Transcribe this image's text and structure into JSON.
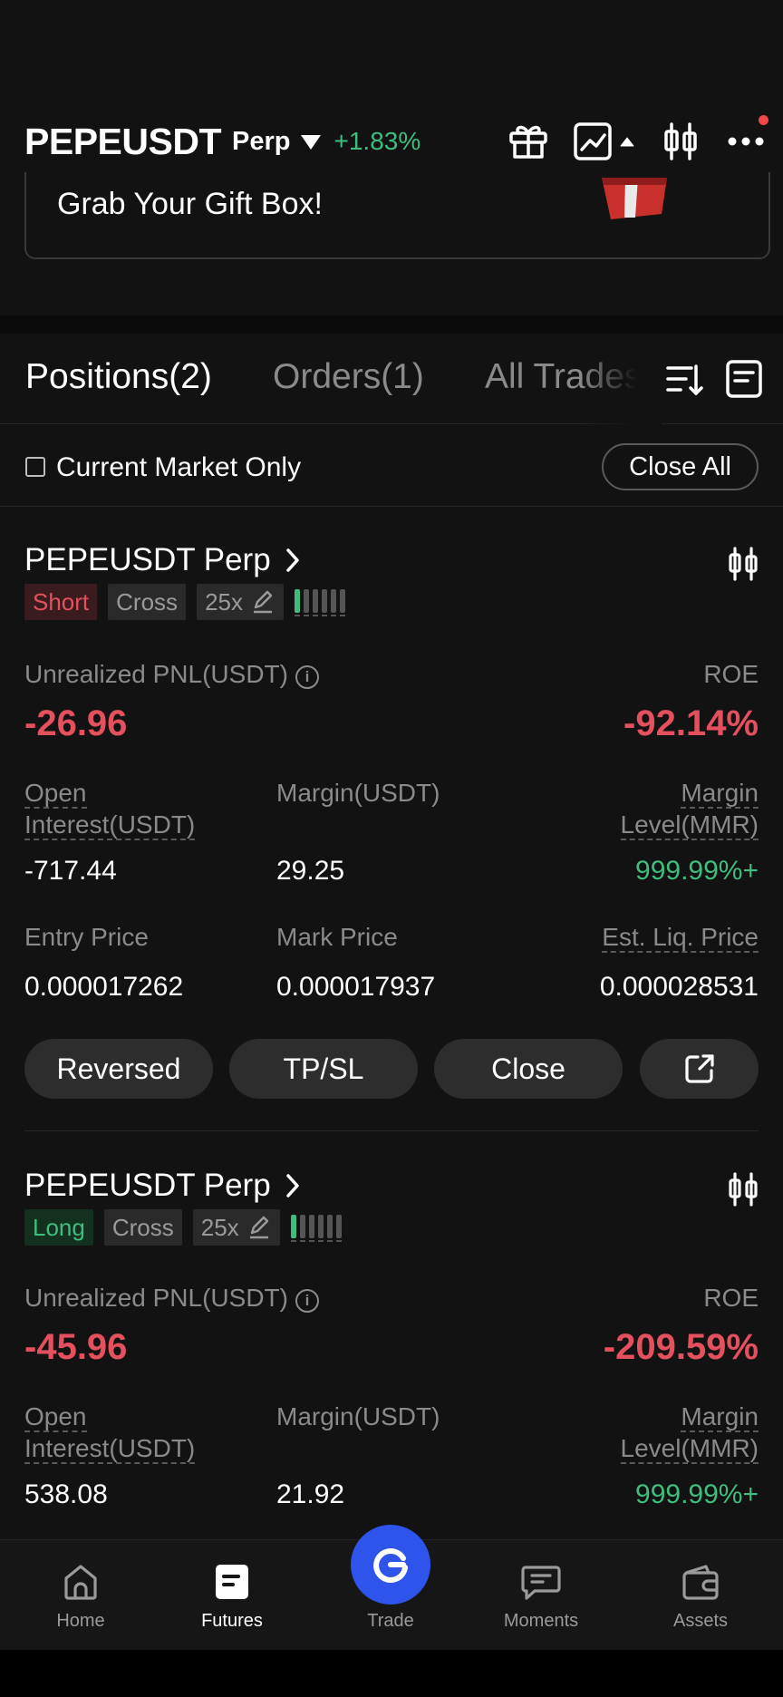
{
  "header": {
    "pair": "PEPEUSDT",
    "type": "Perp",
    "change": "+1.83%"
  },
  "banner": {
    "text": "Grab Your Gift Box!"
  },
  "tabs": [
    {
      "label": "Positions(2)"
    },
    {
      "label": "Orders(1)"
    },
    {
      "label": "All Trades"
    }
  ],
  "filter": {
    "label": "Current Market Only",
    "close_all": "Close All"
  },
  "positions": [
    {
      "symbol": "PEPEUSDT Perp",
      "side": "Short",
      "mode": "Cross",
      "leverage": "25x",
      "pnl_label": "Unrealized PNL(USDT)",
      "pnl": "-26.96",
      "roe_label": "ROE",
      "roe": "-92.14%",
      "oi_label": "Open Interest(USDT)",
      "oi": "-717.44",
      "margin_label": "Margin(USDT)",
      "margin": "29.25",
      "mmr_label": "Margin Level(MMR)",
      "mmr": "999.99%+",
      "entry_label": "Entry Price",
      "entry": "0.000017262",
      "mark_label": "Mark Price",
      "mark": "0.000017937",
      "liq_label": "Est. Liq. Price",
      "liq": "0.000028531",
      "buttons": {
        "reversed": "Reversed",
        "tpsl": "TP/SL",
        "close": "Close"
      }
    },
    {
      "symbol": "PEPEUSDT Perp",
      "side": "Long",
      "mode": "Cross",
      "leverage": "25x",
      "pnl_label": "Unrealized PNL(USDT)",
      "pnl": "-45.96",
      "roe_label": "ROE",
      "roe": "-209.59%",
      "oi_label": "Open Interest(USDT)",
      "oi": "538.08",
      "margin_label": "Margin(USDT)",
      "margin": "21.92",
      "mmr_label": "Margin Level(MMR)",
      "mmr": "999.99%+"
    }
  ],
  "nav": {
    "home": "Home",
    "futures": "Futures",
    "trade": "Trade",
    "moments": "Moments",
    "assets": "Assets"
  },
  "colors": {
    "up": "#3ebd7d",
    "down": "#e4505e",
    "accent": "#2f54eb"
  }
}
